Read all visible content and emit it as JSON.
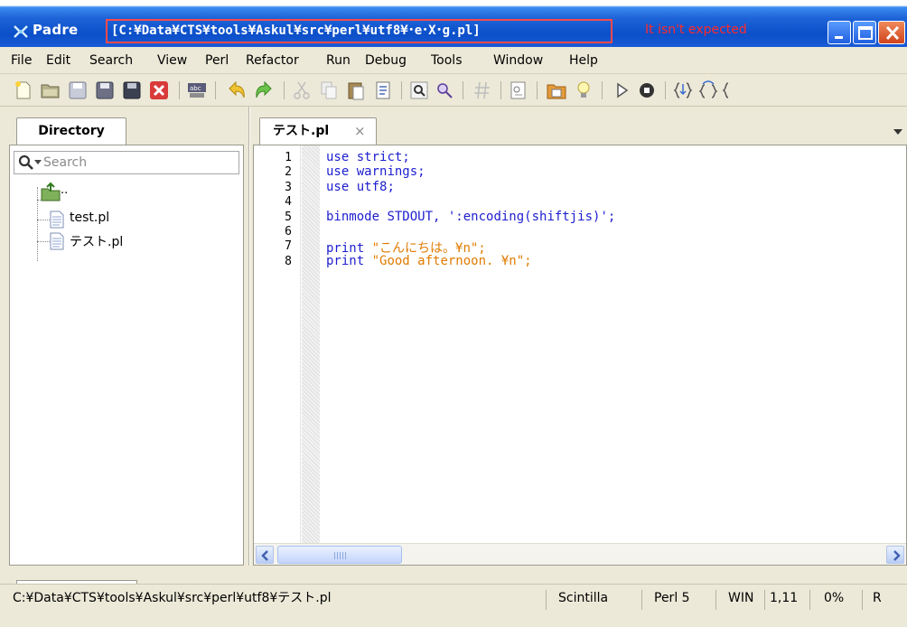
{
  "titlebar": {
    "app_name": "Padre",
    "path_text": "[C:¥Data¥CTS¥tools¥Askul¥src¥perl¥utf8¥･e･X･g.pl]",
    "note": "It isn't expected"
  },
  "menu": {
    "items": [
      "File",
      "Edit",
      "Search",
      "View",
      "Perl",
      "Refactor",
      "Run",
      "Debug",
      "Tools",
      "Window",
      "Help"
    ]
  },
  "directory": {
    "tab_label": "Directory",
    "search_placeholder": "Search",
    "tree": {
      "parent": "..",
      "files": [
        "test.pl",
        "テスト.pl"
      ]
    }
  },
  "editor": {
    "tab_label": "テスト.pl",
    "tab_close": "×",
    "lines": [
      {
        "no": "1",
        "kw": "use",
        "rest": " strict;",
        "str": ""
      },
      {
        "no": "2",
        "kw": "use",
        "rest": " warnings;",
        "str": ""
      },
      {
        "no": "3",
        "kw": "use",
        "rest": " utf8;",
        "str": ""
      },
      {
        "no": "4",
        "kw": "",
        "rest": "",
        "str": ""
      },
      {
        "no": "5",
        "kw": "binmode",
        "rest": " STDOUT, ':encoding(shiftjis)';",
        "str": ""
      },
      {
        "no": "6",
        "kw": "",
        "rest": "",
        "str": ""
      },
      {
        "no": "7",
        "kw": "print",
        "rest": " ",
        "str": "\"こんにちは。¥n\";"
      },
      {
        "no": "8",
        "kw": "print",
        "rest": " ",
        "str": "\"Good afternoon. ¥n\";"
      }
    ]
  },
  "statusbar": {
    "path": "C:¥Data¥CTS¥tools¥Askul¥src¥perl¥utf8¥テスト.pl",
    "editor": "Scintilla",
    "language": "Perl 5",
    "newline": "WIN",
    "position": "1,11",
    "percent": "0%",
    "mode": "R"
  },
  "colors": {
    "title_gradient": "#0b4fc9",
    "annotation_red": "#ff2a2a",
    "keyword_blue": "#1d1dd0",
    "string_orange": "#e07b00",
    "chrome": "#ece9d8"
  }
}
